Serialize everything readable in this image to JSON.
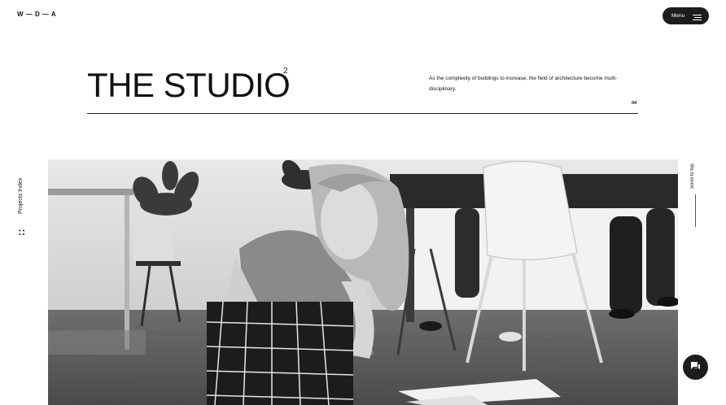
{
  "header": {
    "logo": "W — D — A",
    "menu_label": "Menu",
    "menu_icon": "hamburger-icon"
  },
  "hero_section": {
    "title": "THE STUDIO",
    "superscript": "2",
    "description": "As the complexity of buildings to increase, the field of architecture become multi-disciplinary.",
    "page_number": "04"
  },
  "side_left": {
    "label": "Projects Index",
    "icon": "grid-dots-icon"
  },
  "side_right": {
    "label": "scroll to top"
  },
  "image": {
    "alt": "Woman in black and white studio photo examining drawings on the floor"
  },
  "chat": {
    "icon": "chat-bubble-icon"
  },
  "colors": {
    "text": "#111111",
    "background": "#ffffff",
    "button_bg": "#1d1d1d",
    "button_text": "#ffffff"
  }
}
